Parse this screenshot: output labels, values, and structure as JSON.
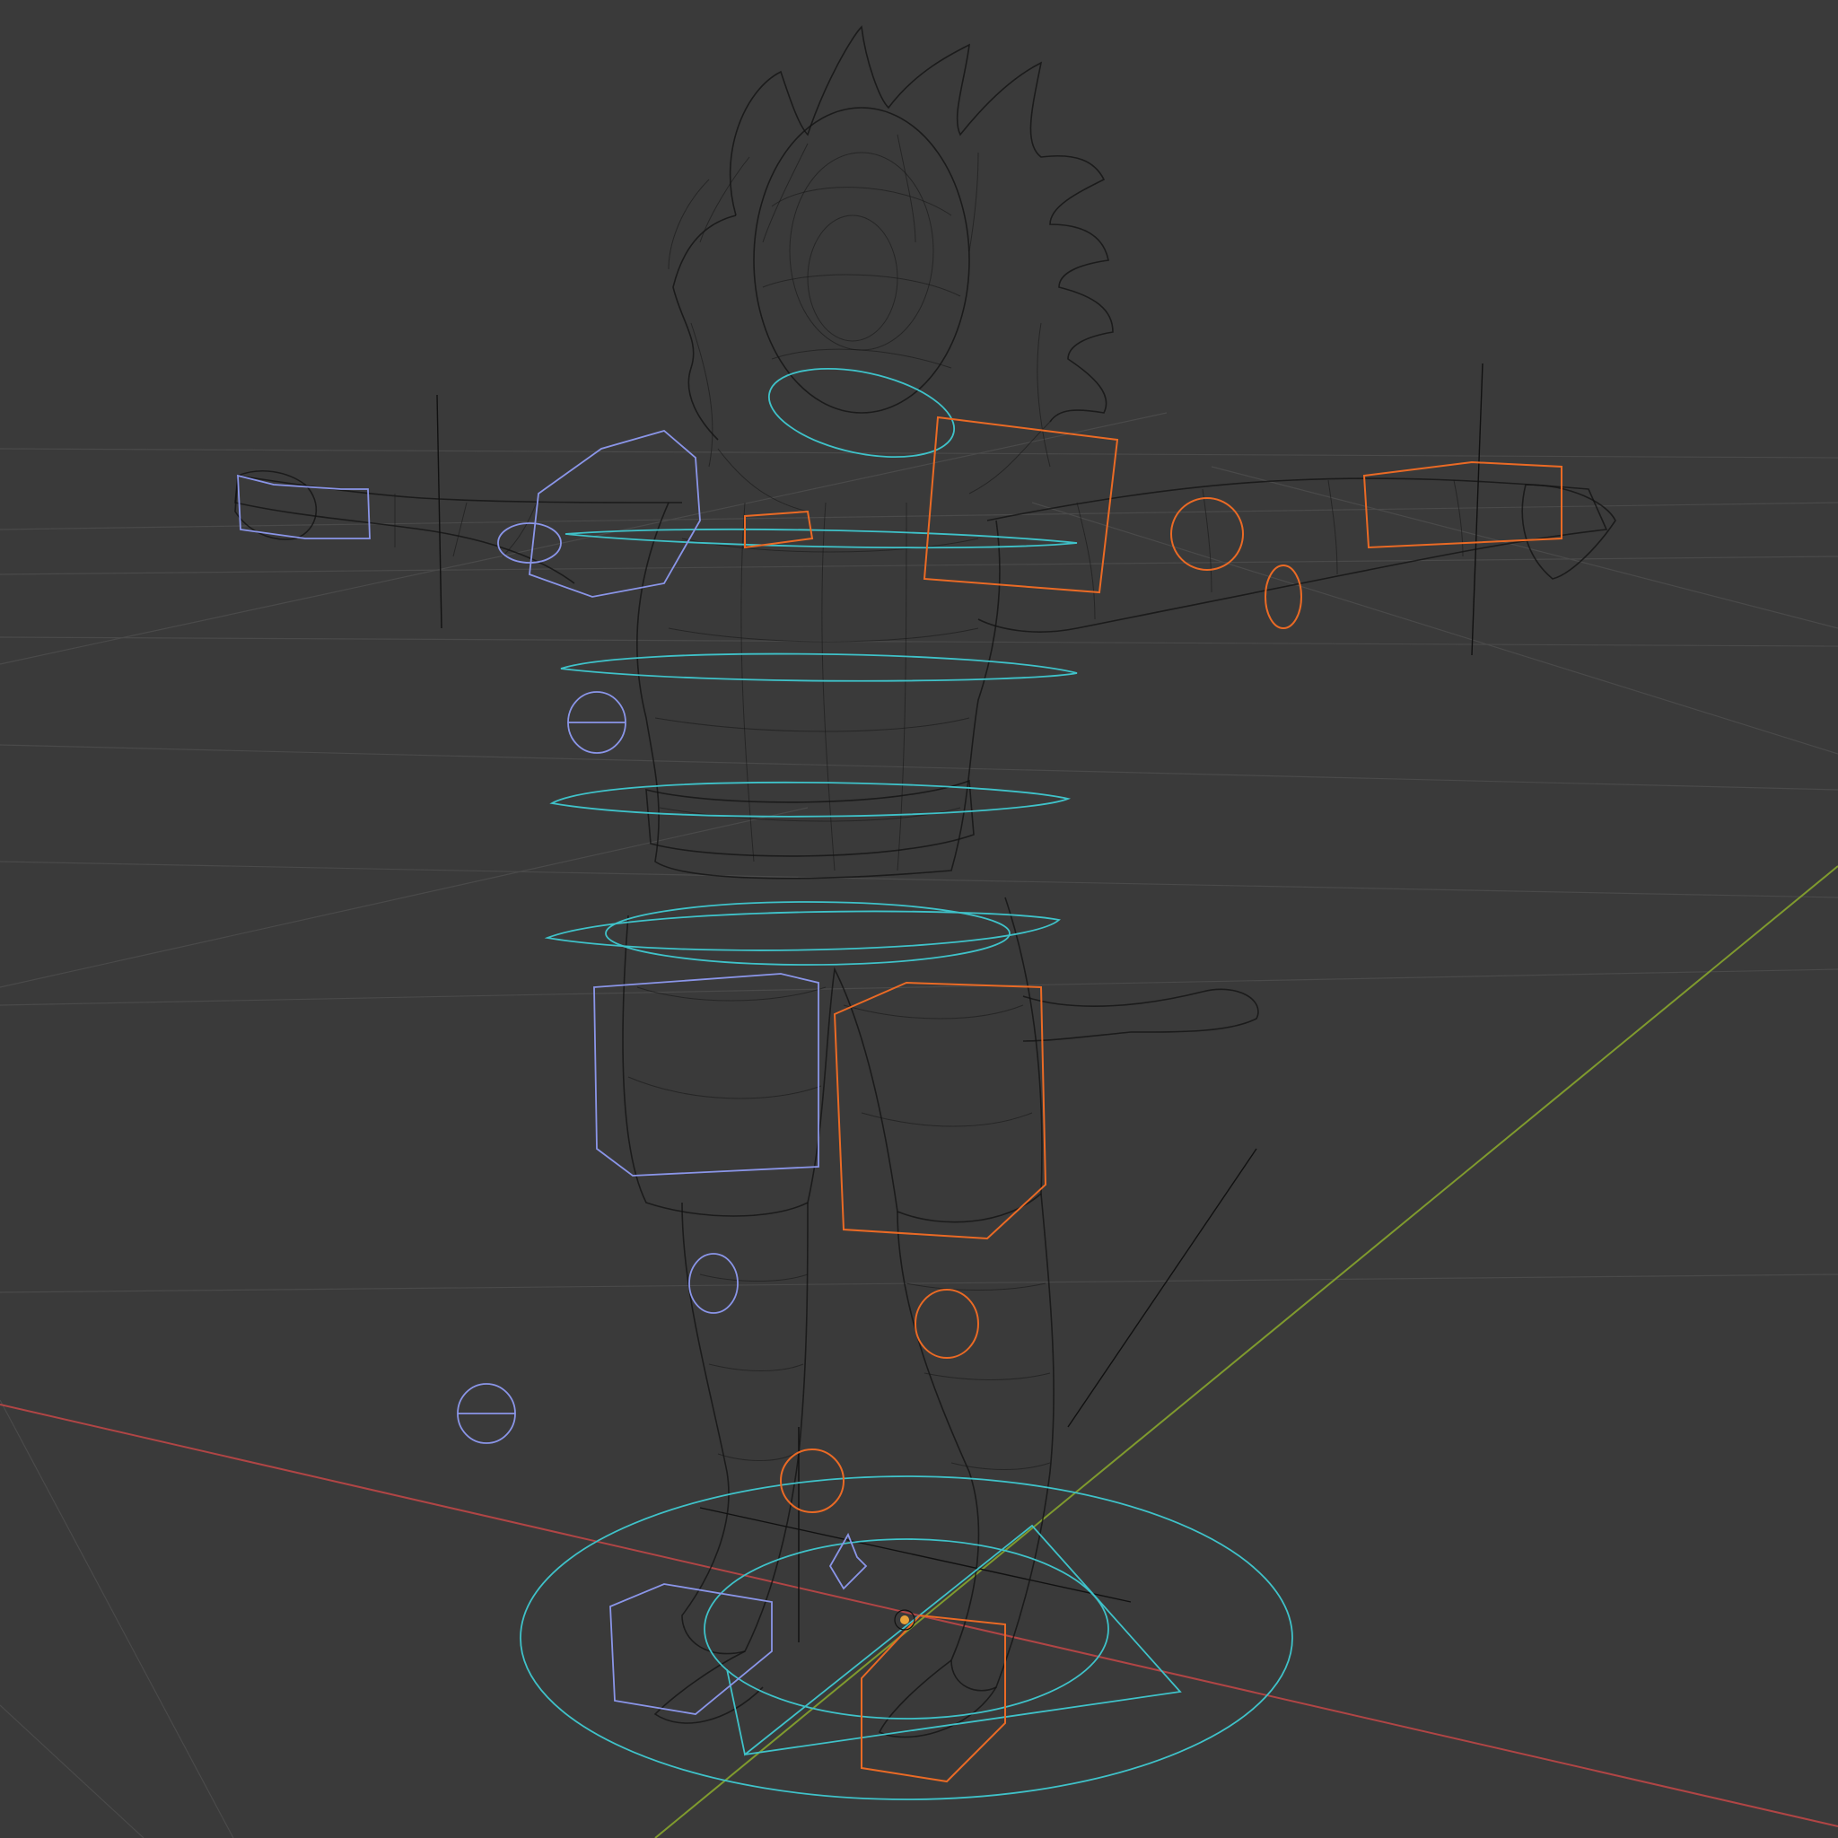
{
  "viewport": {
    "mode": "wireframe",
    "background": "#3a3a3a",
    "colors": {
      "grid": "#4a4a4a",
      "x_axis": "#b04545",
      "y_axis": "#7f9a2e",
      "mesh": "#111111",
      "center_controls": "#3fc2c9",
      "left_controls": "#8a95e8",
      "right_controls": "#ea6a25"
    },
    "objects": [
      {
        "name": "character-mesh",
        "icon": "mesh-icon"
      },
      {
        "name": "armature-rig",
        "icon": "armature-icon"
      },
      {
        "name": "root-control",
        "icon": "circle-control-icon"
      },
      {
        "name": "origin-marker",
        "icon": "origin-dot-icon"
      }
    ]
  }
}
